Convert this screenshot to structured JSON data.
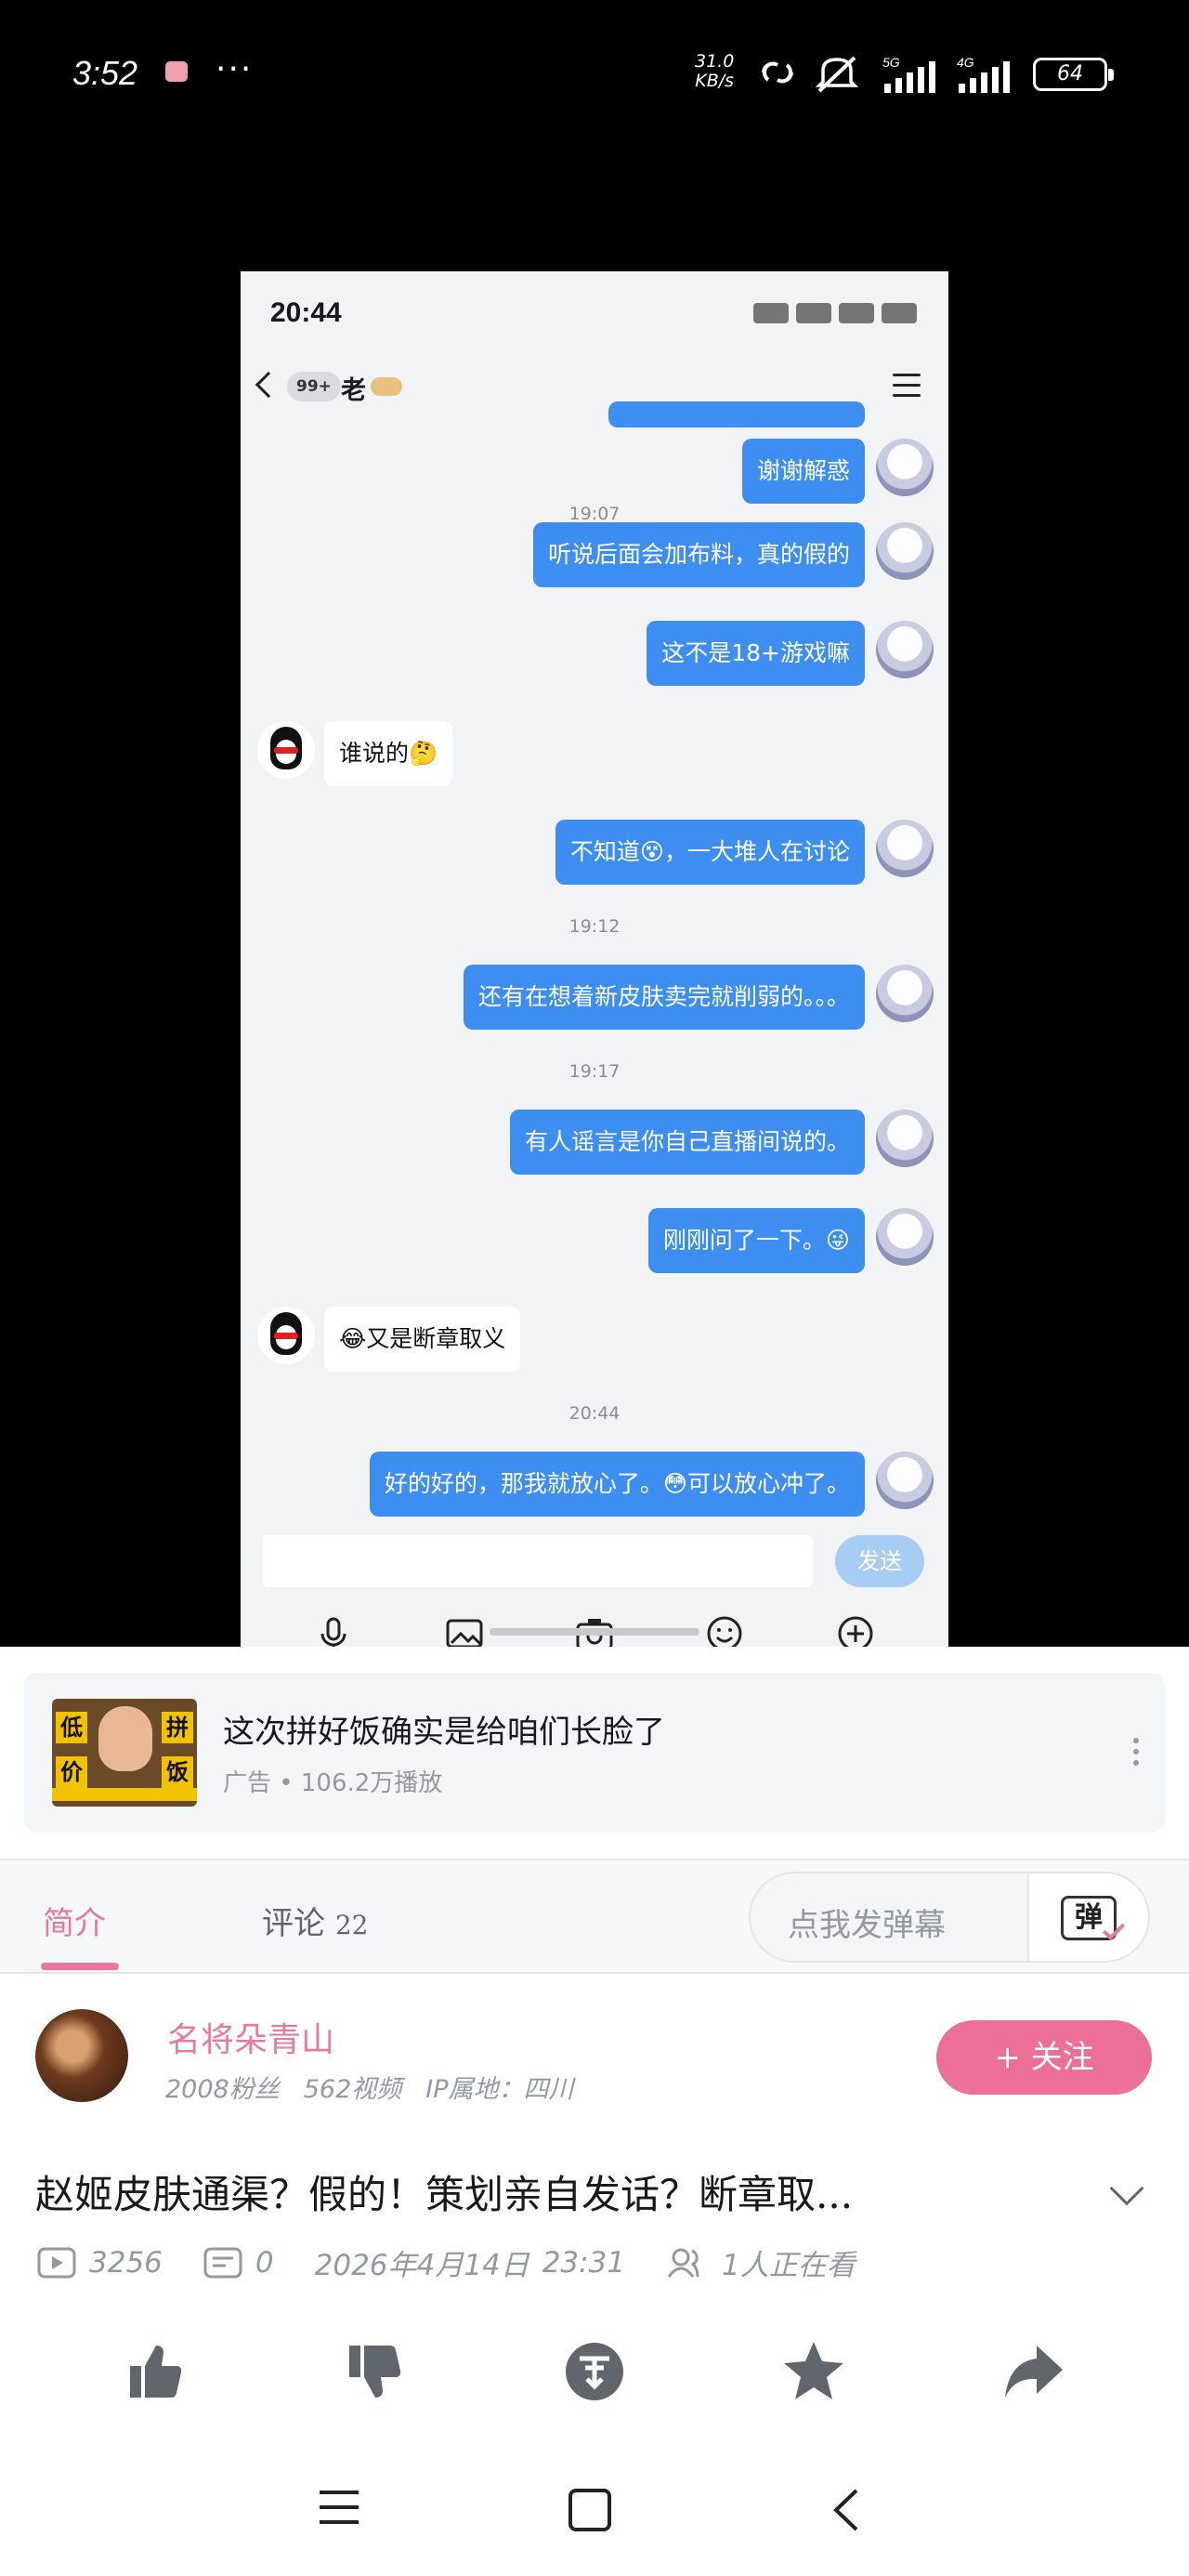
{
  "status_bar": {
    "time": "3:52",
    "dots": "···",
    "net_speed_value": "31.0",
    "net_speed_unit": "KB/s",
    "sim1": "5G",
    "sim2": "4G",
    "battery": "64"
  },
  "chat_screenshot": {
    "time": "20:44",
    "unread_badge": "99+",
    "contact_name": "老",
    "send_label": "发送",
    "messages": [
      {
        "side": "right",
        "text": "谢谢解惑"
      },
      {
        "timestamp": "19:07"
      },
      {
        "side": "right",
        "text": "听说后面会加布料，真的假的"
      },
      {
        "side": "right",
        "text": "这不是18+游戏嘛"
      },
      {
        "side": "left",
        "text": "谁说的🤔"
      },
      {
        "side": "right",
        "text": "不知道😵，一大堆人在讨论"
      },
      {
        "timestamp": "19:12"
      },
      {
        "side": "right",
        "text": "还有在想着新皮肤卖完就削弱的。。。"
      },
      {
        "timestamp": "19:17"
      },
      {
        "side": "right",
        "text": "有人谣言是你自己直播间说的。"
      },
      {
        "side": "right",
        "text": "刚刚问了一下。😜"
      },
      {
        "side": "left",
        "text": "😂又是断章取义"
      },
      {
        "timestamp": "20:44"
      },
      {
        "side": "right",
        "text": "好的好的，那我就放心了。😳可以放心冲了。"
      }
    ]
  },
  "ad": {
    "title": "这次拼好饭确实是给咱们长脸了",
    "subtitle": "广告 • 106.2万播放",
    "thumb_tags": [
      "低",
      "拼",
      "价",
      "饭"
    ]
  },
  "tabs": {
    "intro": "简介",
    "comments": "评论",
    "comments_count": "22",
    "danmaku_placeholder": "点我发弹幕",
    "danmaku_icon_text": "弹"
  },
  "uploader": {
    "name": "名将朵青山",
    "fans": "2008粉丝",
    "videos": "562视频",
    "ip": "IP属地：四川",
    "follow_label": "+ 关注"
  },
  "video": {
    "title": "赵姬皮肤通渠？假的！策划亲自发话？断章取...",
    "plays": "3256",
    "danmaku_count": "0",
    "date": "2026年4月14日",
    "time": "23:31",
    "watching": "1人正在看"
  },
  "icons": [
    "like-icon",
    "dislike-icon",
    "coin-icon",
    "favorite-icon",
    "share-icon",
    "menu-icon",
    "home-icon",
    "back-icon"
  ]
}
